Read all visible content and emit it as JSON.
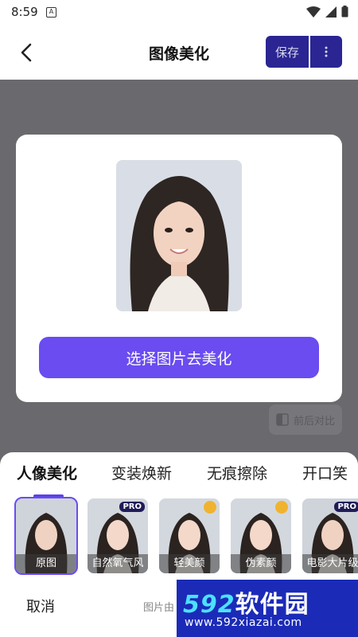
{
  "status_bar": {
    "time": "8:59",
    "notification_icon": "A"
  },
  "header": {
    "title": "图像美化",
    "save_label": "保存",
    "more_icon": "more-vertical-icon",
    "back_icon": "back-icon"
  },
  "modal": {
    "select_button_label": "选择图片去美化"
  },
  "compare": {
    "label": "前后对比"
  },
  "tabs": [
    {
      "label": "人像美化",
      "active": true
    },
    {
      "label": "变装焕新",
      "active": false
    },
    {
      "label": "无痕擦除",
      "active": false
    },
    {
      "label": "开口笑",
      "active": false
    }
  ],
  "thumbnails": [
    {
      "label": "原图",
      "badge": "",
      "selected": true
    },
    {
      "label": "自然氧气风",
      "badge": "PRO",
      "selected": false
    },
    {
      "label": "轻美颜",
      "badge": "crown",
      "selected": false
    },
    {
      "label": "伪素颜",
      "badge": "crown",
      "selected": false
    },
    {
      "label": "电影大片级",
      "badge": "PRO",
      "selected": false
    }
  ],
  "footer": {
    "cancel_label": "取消",
    "note": "图片由"
  },
  "watermark": {
    "brand_num": "592",
    "brand_text": "软件园",
    "url": "www.592xiazai.com"
  },
  "colors": {
    "accent": "#6a4cf0",
    "save_bg": "#2a2592",
    "overlay": "#6a6a6e"
  }
}
